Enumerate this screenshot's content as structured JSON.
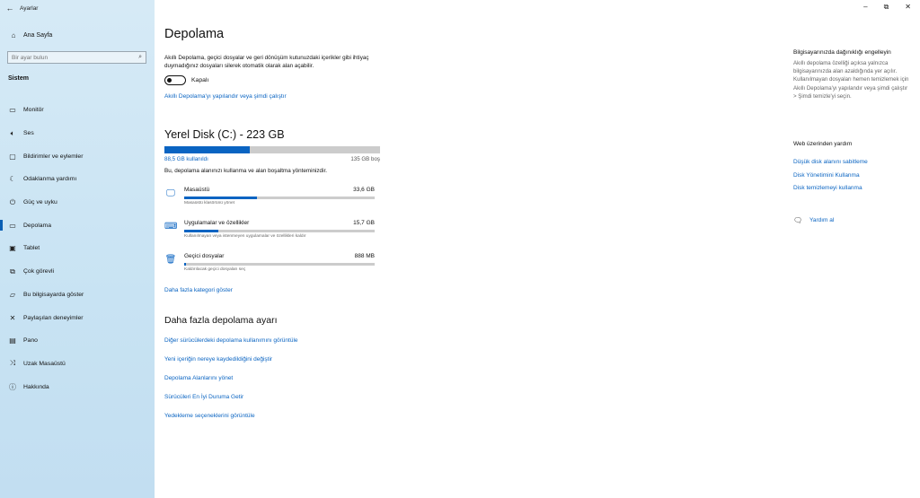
{
  "window": {
    "title": "Ayarlar",
    "back_icon": "←",
    "minimize_icon": "–",
    "restore_icon": "⧉",
    "close_icon": "✕"
  },
  "sidebar": {
    "home_label": "Ana Sayfa",
    "search_placeholder": "Bir ayar bulun",
    "section": "Sistem",
    "items": [
      {
        "label": "Monitör",
        "icon": "monitor-icon"
      },
      {
        "label": "Ses",
        "icon": "speaker-icon"
      },
      {
        "label": "Bildirimler ve eylemler",
        "icon": "notification-icon"
      },
      {
        "label": "Odaklanma yardımı",
        "icon": "moon-icon"
      },
      {
        "label": "Güç ve uyku",
        "icon": "power-icon"
      },
      {
        "label": "Depolama",
        "icon": "storage-icon"
      },
      {
        "label": "Tablet",
        "icon": "tablet-icon"
      },
      {
        "label": "Çok görevli",
        "icon": "multitask-icon"
      },
      {
        "label": "Bu bilgisayarda göster",
        "icon": "project-icon"
      },
      {
        "label": "Paylaşılan deneyimler",
        "icon": "share-icon"
      },
      {
        "label": "Pano",
        "icon": "clipboard-icon"
      },
      {
        "label": "Uzak Masaüstü",
        "icon": "remote-icon"
      },
      {
        "label": "Hakkında",
        "icon": "info-icon"
      }
    ],
    "active_index": 5
  },
  "main": {
    "title": "Depolama",
    "description": "Akıllı Depolama, geçici dosyalar ve geri dönüşüm kutunuzdaki içerikler gibi ihtiyaç duymadığınız dosyaları silerek otomatik olarak alan açabilir.",
    "toggle_label": "Kapalı",
    "config_link": "Akıllı Depolama'yı yapılandır veya şimdi çalıştır",
    "disk": {
      "title": "Yerel Disk (C:) - 223 GB",
      "used_label": "88,5 GB kullanıldı",
      "free_label": "135 GB boş",
      "used_fraction": 0.397
    },
    "usage_desc": "Bu, depolama alanınızı kullanma ve alan boşaltma yönteminizdir.",
    "categories": [
      {
        "name": "Masaüstü",
        "size": "33,6 GB",
        "sub": "Masaüstü klasörünü yönet",
        "fraction": 0.38
      },
      {
        "name": "Uygulamalar ve özellikler",
        "size": "15,7 GB",
        "sub": "Kullanılmayan veya istenmeyen uygulamalar ve özellikleri kaldır",
        "fraction": 0.18
      },
      {
        "name": "Geçici dosyalar",
        "size": "888 MB",
        "sub": "Kaldırılacak geçici dosyaları seç",
        "fraction": 0.01
      }
    ],
    "more_categories": "Daha fazla kategori göster",
    "more_title": "Daha fazla depolama ayarı",
    "more_links": [
      "Diğer sürücülerdeki depolama kullanımını görüntüle",
      "Yeni içeriğin nereye kaydedildiğini değiştir",
      "Depolama Alanlarını yönet",
      "Sürücüleri En İyi Duruma Getir",
      "Yedekleme seçeneklerini görüntüle"
    ]
  },
  "right": {
    "heading": "Bilgisayarınızda dağınıklığı engelleyin",
    "text": "Akıllı depolama özelliği açıksa yalnızca bilgisayarınızda alan azaldığında yer açılır. Kullanılmayan dosyaları hemen temizlemek için Akıllı Depolama'yı yapılandır veya şimdi çalıştır > Şimdi temizle'yi seçin.",
    "web_heading": "Web üzerinden yardım",
    "web_links": [
      "Düşük disk alanını sabitleme",
      "Disk Yönetimini Kullanma",
      "Disk temizlemeyi kullanma"
    ],
    "help_label": "Yardım al"
  },
  "colors": {
    "accent": "#0a64c2",
    "sidebar_bg": "#c8e3f3"
  }
}
